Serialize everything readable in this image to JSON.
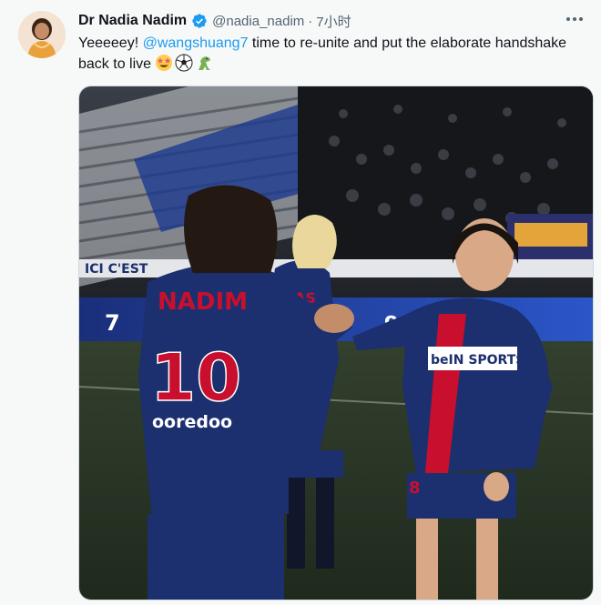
{
  "author": {
    "name": "Dr Nadia Nadim",
    "handle": "@nadia_nadim",
    "separator": "·",
    "time": "7小时"
  },
  "icons": {
    "verified": "verified-badge-icon",
    "more": "more-options-icon",
    "emoji_1": "star-struck-emoji",
    "emoji_2": "soccer-ball-emoji",
    "emoji_3": "t-rex-emoji"
  },
  "tweet": {
    "text_start": "Yeeeeey! ",
    "mention": "@wangshuang7",
    "text_end": " time to re-unite and put the elaborate handshake back to live "
  },
  "photo": {
    "jersey_name": "NADIM",
    "jersey_number": "10",
    "jersey_sponsor": "ooredoo",
    "sponsor_right": "beIN SPORTS",
    "second_number": "8",
    "board_left": "ICI C'EST",
    "board_left_num": "7",
    "board_right": "oo"
  },
  "colors": {
    "accent": "#1d9bf0",
    "text_primary": "#0f1419",
    "text_secondary": "#536471",
    "psg_navy": "#1c2f6e",
    "psg_red": "#c8102e"
  }
}
